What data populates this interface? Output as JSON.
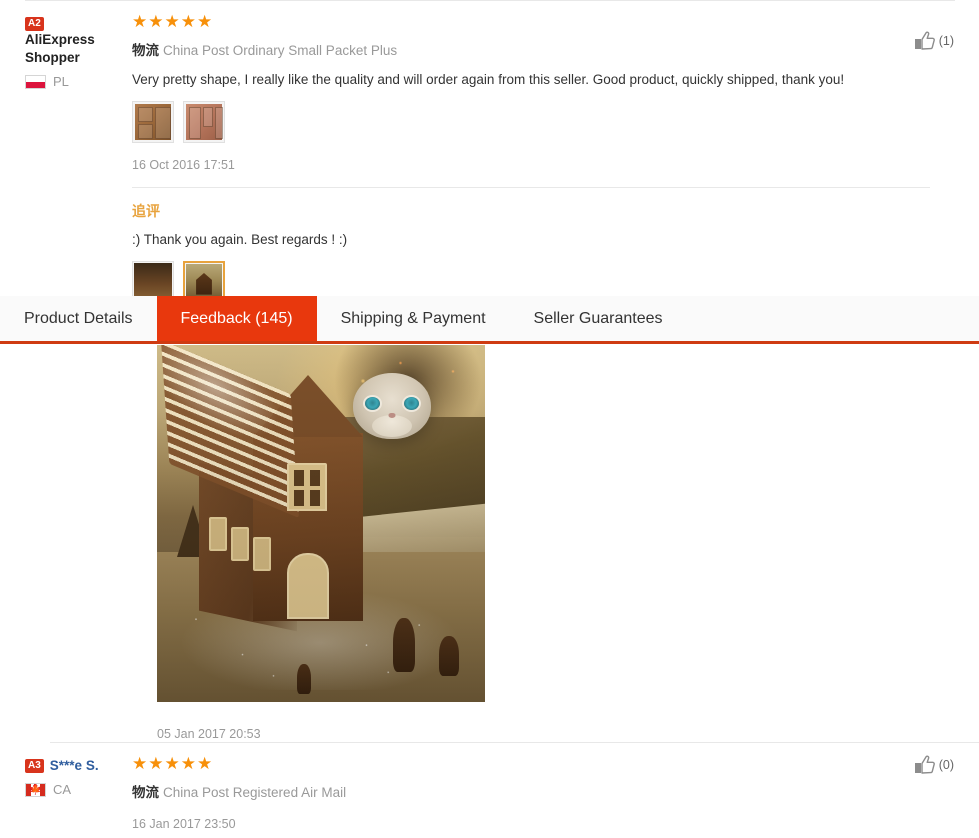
{
  "tabs": [
    {
      "label": "Product Details",
      "active": false
    },
    {
      "label": "Feedback (145)",
      "active": true
    },
    {
      "label": "Shipping & Payment",
      "active": false
    },
    {
      "label": "Seller Guarantees",
      "active": false
    }
  ],
  "colors": {
    "tab_active_bg": "#e8380d",
    "tab_bar_border": "#cf3b12",
    "star": "#f7900a",
    "rank_badge": "#d8341c",
    "append_title": "#e8a33d",
    "link": "#2f5d9e",
    "muted_text": "#999999"
  },
  "reviews": [
    {
      "rank_badge": "A2",
      "user_name": "AliExpress Shopper",
      "user_is_link": false,
      "country_code": "PL",
      "country_flag": "poland-flag",
      "stars": "★★★★★",
      "rating": 5,
      "logistics_label": "物流",
      "logistics_name": "China Post Ordinary Small Packet Plus",
      "text": "Very pretty shape, I really like the quality and will order again from this seller. Good product, quickly shipped, thank you!",
      "thumbnails": [
        {
          "alt": "chocolate-mold-tan",
          "selected": false
        },
        {
          "alt": "chocolate-mold-pink",
          "selected": false
        }
      ],
      "timestamp": "16 Oct 2016 17:51",
      "helpful_icon": "thumbs-up-icon",
      "helpful_count": "(1)",
      "append": {
        "title": "追评",
        "text": ":) Thank you again. Best regards ! :)",
        "thumbnails": [
          {
            "alt": "gingerbread-house-dark",
            "selected": false
          },
          {
            "alt": "gingerbread-house-lit",
            "selected": true
          }
        ],
        "big_photo_alt": "gingerbread-house-with-cat",
        "timestamp": "05 Jan 2017 20:53"
      }
    },
    {
      "rank_badge": "A3",
      "user_name": "S***e S.",
      "user_is_link": true,
      "country_code": "CA",
      "country_flag": "canada-flag",
      "stars": "★★★★★",
      "rating": 5,
      "logistics_label": "物流",
      "logistics_name": "China Post Registered Air Mail",
      "text": "",
      "thumbnails": [],
      "timestamp": "16 Jan 2017 23:50",
      "helpful_icon": "thumbs-up-icon",
      "helpful_count": "(0)"
    }
  ]
}
